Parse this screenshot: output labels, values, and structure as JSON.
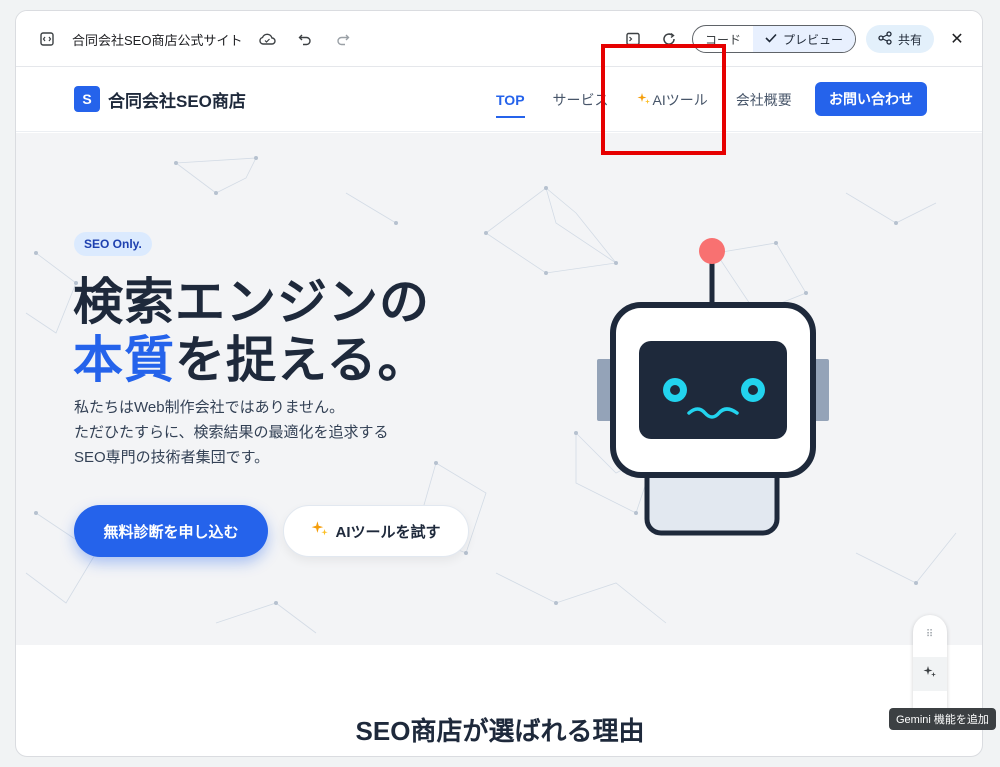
{
  "editor": {
    "title": "合同会社SEO商店公式サイト",
    "toggle_code": "コード",
    "toggle_preview": "プレビュー",
    "share_label": "共有"
  },
  "site": {
    "brand_letter": "S",
    "brand_name": "合同会社SEO商店",
    "nav": [
      "TOP",
      "サービス",
      "AIツール",
      "会社概要"
    ],
    "nav_cta": "お問い合わせ"
  },
  "hero": {
    "badge": "SEO Only.",
    "headline_line1": "検索エンジンの",
    "headline_accent": "本質",
    "headline_line2_rest": "を捉える。",
    "desc_lines": [
      "私たちはWeb制作会社ではありません。",
      "ただひたすらに、検索結果の最適化を追求する",
      "SEO専門の技術者集団です。"
    ],
    "primary_button": "無料診断を申し込む",
    "secondary_button": "AIツールを試す"
  },
  "section": {
    "title": "SEO商店が選ばれる理由"
  },
  "gemini": {
    "tooltip": "Gemini 機能を追加"
  },
  "colors": {
    "accent": "#2563eb",
    "highlight_box": "#e60000",
    "spark": "#f59e0b"
  }
}
